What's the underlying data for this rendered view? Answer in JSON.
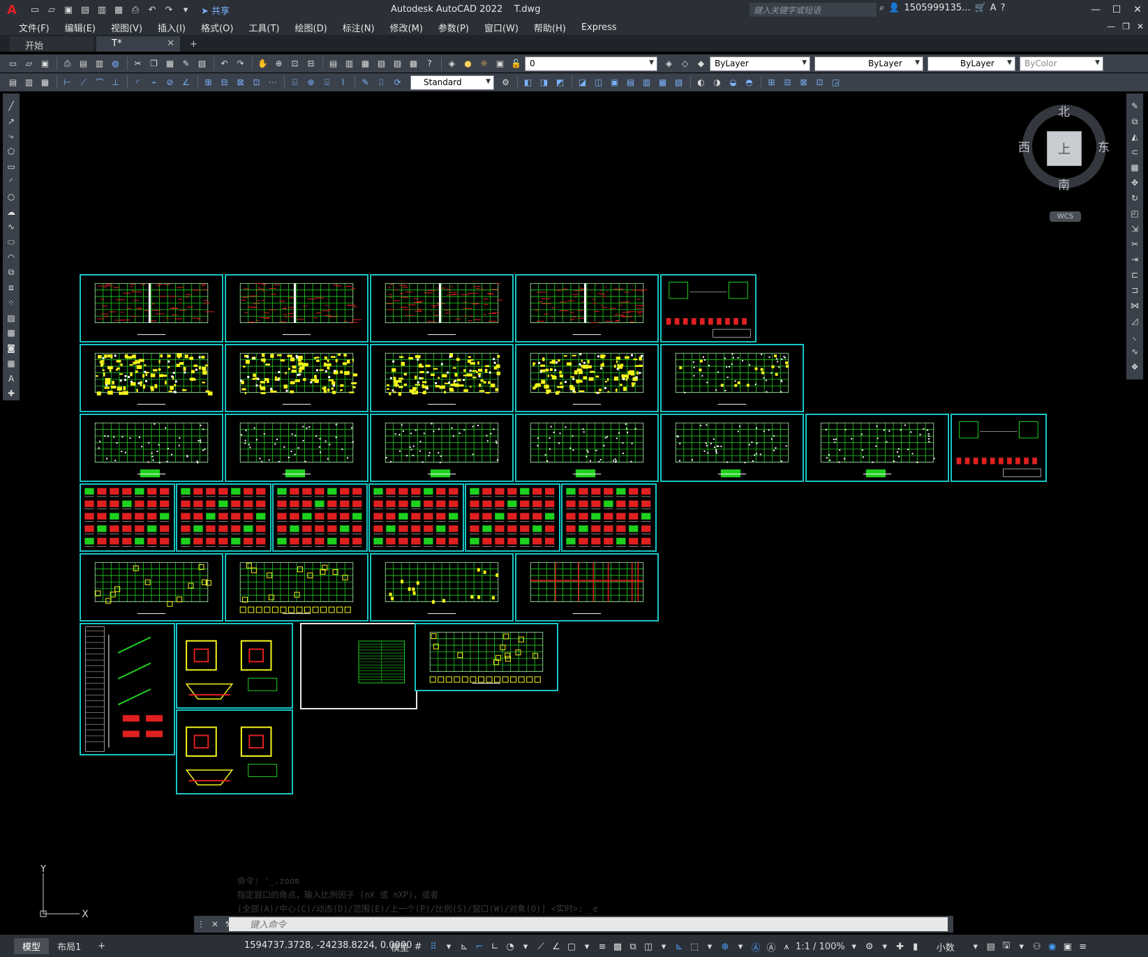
{
  "titlebar": {
    "app_logo": "A",
    "share_label": "共享",
    "title": "Autodesk AutoCAD 2022    T.dwg",
    "search_placeholder": "键入关键字或短语",
    "user": "1505999135...",
    "window_controls": [
      "minimize",
      "maximize",
      "close"
    ]
  },
  "menu": {
    "items": [
      "文件(F)",
      "编辑(E)",
      "视图(V)",
      "插入(I)",
      "格式(O)",
      "工具(T)",
      "绘图(D)",
      "标注(N)",
      "修改(M)",
      "参数(P)",
      "窗口(W)",
      "帮助(H)",
      "Express"
    ]
  },
  "file_tabs": {
    "tabs": [
      {
        "label": "开始"
      },
      {
        "label": "T*"
      }
    ],
    "add_label": "+"
  },
  "toolbar1": {
    "layer_value": "0",
    "color_value": "ByLayer",
    "linetype_value": "ByLayer",
    "lineweight_value": "ByLayer",
    "plotstyle_value": "ByColor"
  },
  "toolbar2": {
    "textstyle_value": "Standard"
  },
  "viewcube": {
    "north": "北",
    "south": "南",
    "east": "东",
    "west": "西",
    "face": "上",
    "wcs_label": "WCS"
  },
  "ucs": {
    "x_label": "X",
    "y_label": "Y"
  },
  "command": {
    "history": [
      "命令: '_.zoom",
      "指定窗口的角点，输入比例因子 (nX 或 nXP)，或者",
      "[全部(A)/中心(C)/动态(D)/范围(E)/上一个(P)/比例(S)/窗口(W)/对象(O)] <实时>: _e"
    ],
    "input_placeholder": "键入命令"
  },
  "statusbar": {
    "layout_tabs": [
      "模型",
      "布局1"
    ],
    "add_label": "+",
    "coordinates": "1594737.3728, -24238.8224, 0.0000",
    "space_label": "模型",
    "scale_label": "1:1 / 100%",
    "units_label": "小数"
  },
  "colors": {
    "sheet_border": "#19c6c6",
    "green": "#1fd11f",
    "red": "#e02020",
    "yellow": "#f5f51a",
    "background": "#000000"
  }
}
